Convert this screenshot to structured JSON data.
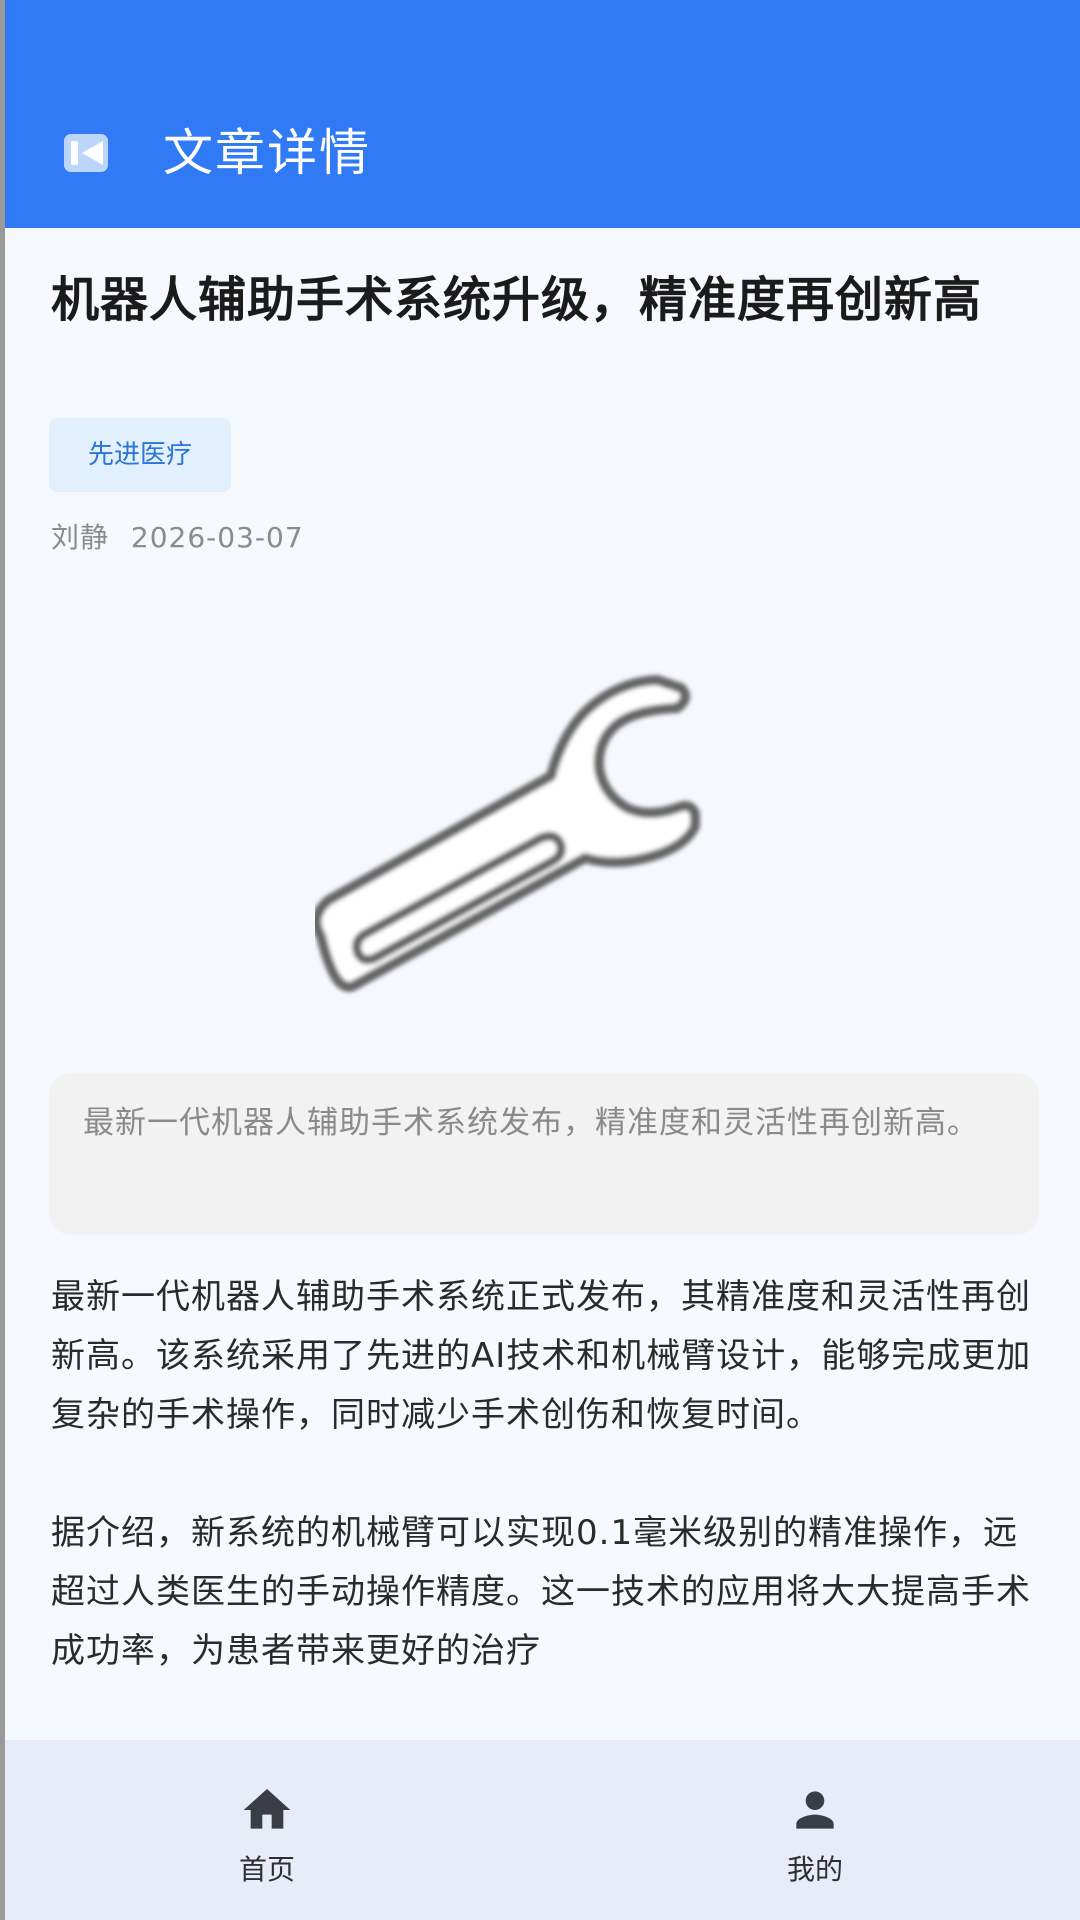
{
  "appbar": {
    "back_icon": "back-icon",
    "title": "文章详情",
    "color": "#307bf5"
  },
  "article": {
    "title": "机器人辅助手术系统升级，精准度再创新高",
    "tag": "先进医疗",
    "author": "刘静",
    "date": "2026-03-07",
    "hero_icon": "wrench-icon",
    "summary": "最新一代机器人辅助手术系统发布，精准度和灵活性再创新高。",
    "paragraphs": [
      "最新一代机器人辅助手术系统正式发布，其精准度和灵活性再创新高。该系统采用了先进的AI技术和机械臂设计，能够完成更加复杂的手术操作，同时减少手术创伤和恢复时间。",
      "据介绍，新系统的机械臂可以实现0.1毫米级别的精准操作，远超过人类医生的手动操作精度。这一技术的应用将大大提高手术成功率，为患者带来更好的治疗"
    ]
  },
  "bottom_nav": {
    "items": [
      {
        "label": "首页",
        "icon": "home-icon"
      },
      {
        "label": "我的",
        "icon": "person-icon"
      }
    ]
  }
}
